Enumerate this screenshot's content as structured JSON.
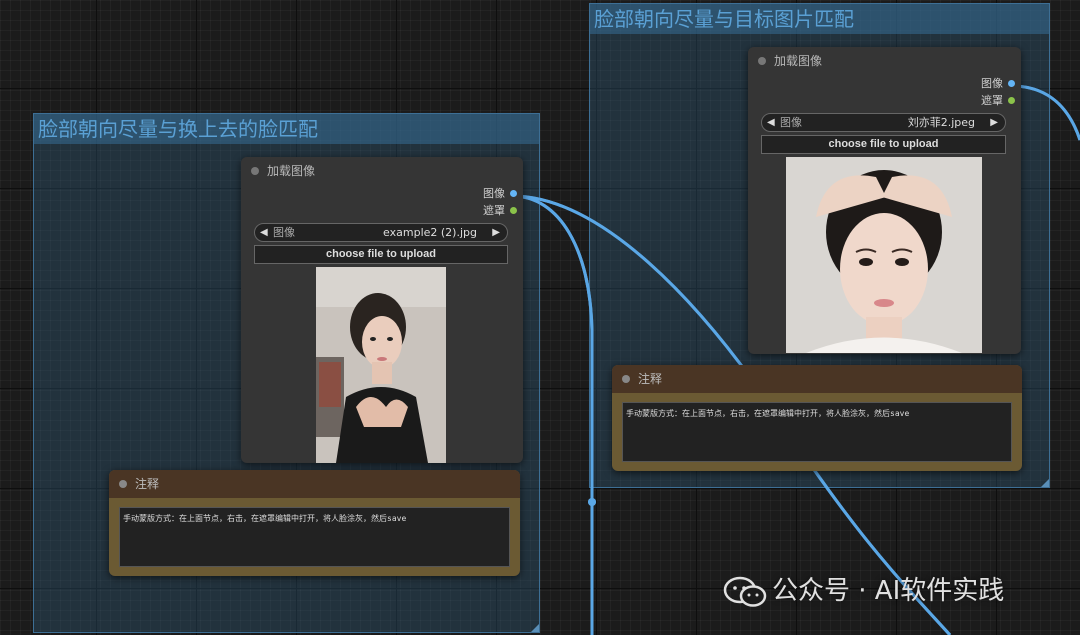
{
  "groups": [
    {
      "title": "脸部朝向尽量与换上去的脸匹配"
    },
    {
      "title": "脸部朝向尽量与目标图片匹配"
    }
  ],
  "nodes": [
    {
      "title": "加载图像",
      "outputs": [
        {
          "label": "图像",
          "color": "#64b5f6"
        },
        {
          "label": "遮罩",
          "color": "#8bc34a"
        }
      ],
      "combo": {
        "label": "图像",
        "value": "example2 (2).jpg"
      },
      "upload_label": "choose file to upload"
    },
    {
      "title": "加载图像",
      "outputs": [
        {
          "label": "图像",
          "color": "#64b5f6"
        },
        {
          "label": "遮罩",
          "color": "#8bc34a"
        }
      ],
      "combo": {
        "label": "图像",
        "value": "刘亦菲2.jpeg"
      },
      "upload_label": "choose file to upload"
    }
  ],
  "notes": [
    {
      "title": "注释",
      "text": "手动蒙版方式：在上面节点，右击，在遮罩编辑中打开，将人脸涂灰，然后save"
    },
    {
      "title": "注释",
      "text": "手动蒙版方式：在上面节点，右击，在遮罩编辑中打开，将人脸涂灰，然后save"
    }
  ],
  "watermark": {
    "text": "公众号 · AI软件实践"
  },
  "icons": {
    "prev": "◀",
    "next": "▶"
  },
  "colors": {
    "wire": "#5aa7e6",
    "group_title": "#5aa0d4",
    "note_body": "#6b5a33"
  }
}
